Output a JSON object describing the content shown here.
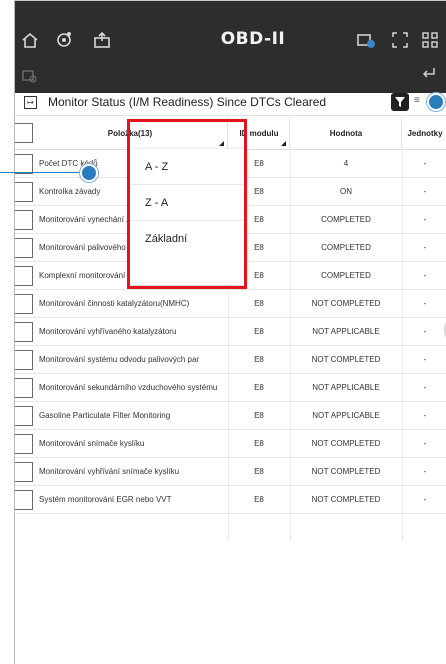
{
  "header": {
    "title": "OBD-II",
    "icons": [
      "home-icon",
      "engine-icon",
      "upload-car-icon",
      "battery-car-icon",
      "fullscreen-icon",
      "grid-icon",
      "sub-car-icon",
      "return-icon"
    ]
  },
  "status": {
    "title": "Monitor Status (I/M Readiness) Since DTCs Cleared"
  },
  "table": {
    "columns": [
      "Položka(13)",
      "ID modulu",
      "Hodnota",
      "Jednotky"
    ],
    "rows": [
      {
        "name": "Počet DTC kódů",
        "module": "E8",
        "value": "4",
        "unit": "-"
      },
      {
        "name": "Kontrolka závady",
        "module": "E8",
        "value": "ON",
        "unit": "-"
      },
      {
        "name": "Monitorování vynechání zapalování",
        "module": "E8",
        "value": "COMPLETED",
        "unit": "-"
      },
      {
        "name": "Monitorování palivového systému",
        "module": "E8",
        "value": "COMPLETED",
        "unit": "-"
      },
      {
        "name": "Komplexní monitorování komponentů",
        "module": "E8",
        "value": "COMPLETED",
        "unit": "-"
      },
      {
        "name": "Monitorování činnosti katalyzátoru(NMHC)",
        "module": "E8",
        "value": "NOT COMPLETED",
        "unit": "-"
      },
      {
        "name": "Monitorování vyhřívaného katalyzátoru",
        "module": "E8",
        "value": "NOT APPLICABLE",
        "unit": "-"
      },
      {
        "name": "Monitorování systému odvodu palivových par",
        "module": "E8",
        "value": "NOT COMPLETED",
        "unit": "-"
      },
      {
        "name": "Monitorování sekundárního vzduchového systému",
        "module": "E8",
        "value": "NOT APPLICABLE",
        "unit": "-"
      },
      {
        "name": "Gasoline Particulate Filter Monitoring",
        "module": "E8",
        "value": "NOT APPLICABLE",
        "unit": "-"
      },
      {
        "name": "Monitorování snímače kyslíku",
        "module": "E8",
        "value": "NOT COMPLETED",
        "unit": "-"
      },
      {
        "name": "Monitorování vyhřívání snímače kyslíku",
        "module": "E8",
        "value": "NOT COMPLETED",
        "unit": "-"
      },
      {
        "name": "Systém monitorování EGR nebo VVT",
        "module": "E8",
        "value": "NOT COMPLETED",
        "unit": "-"
      }
    ]
  },
  "sort_menu": {
    "options": [
      "A - Z",
      "Z - A",
      "Základní"
    ]
  },
  "colors": {
    "header_bg": "#2d2d2d",
    "highlight": "#e3141b",
    "callout": "#2b7bbf"
  }
}
